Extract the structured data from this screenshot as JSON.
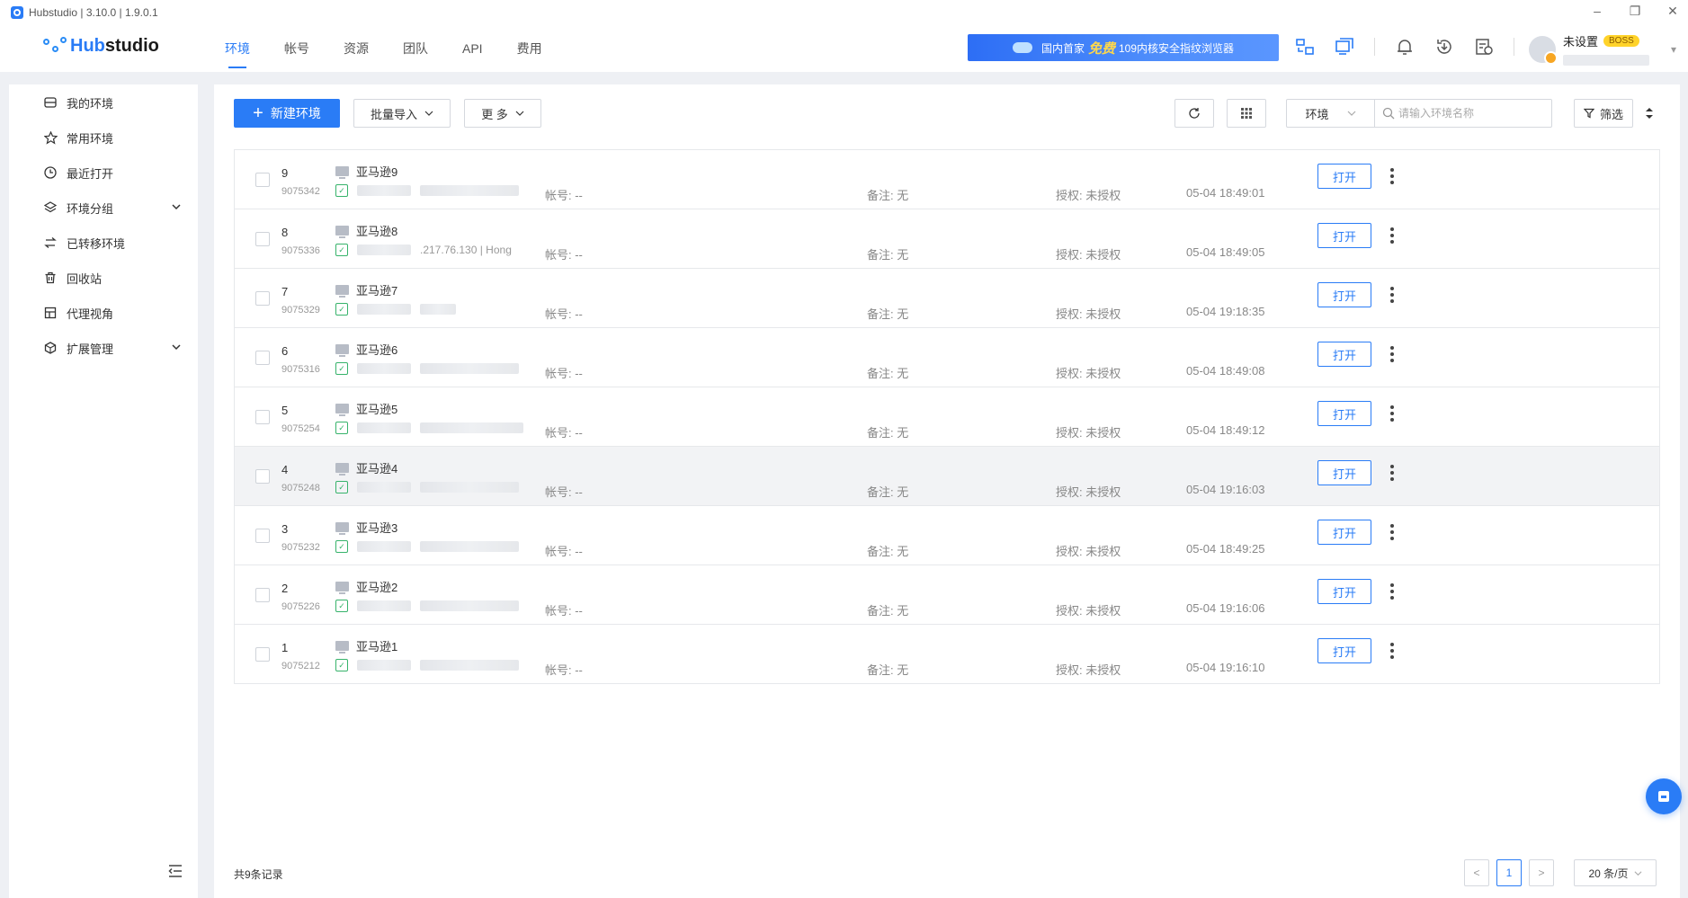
{
  "window": {
    "title": "Hubstudio | 3.10.0 | 1.9.0.1",
    "controls": [
      "–",
      "❐",
      "✕"
    ]
  },
  "brand": {
    "prefix": "Hub",
    "suffix": "studio"
  },
  "topnav": [
    {
      "label": "环境",
      "active": true
    },
    {
      "label": "帐号",
      "active": false
    },
    {
      "label": "资源",
      "active": false
    },
    {
      "label": "团队",
      "active": false
    },
    {
      "label": "API",
      "active": false
    },
    {
      "label": "费用",
      "active": false
    }
  ],
  "banner": {
    "pre": "国内首家",
    "free": "免费",
    "post": "109内核安全指纹浏览器"
  },
  "user": {
    "name": "未设置",
    "badge": "BOSS"
  },
  "sidebar": {
    "items": [
      {
        "label": "我的环境",
        "icon": "my-env-icon"
      },
      {
        "label": "常用环境",
        "icon": "star-icon"
      },
      {
        "label": "最近打开",
        "icon": "clock-icon"
      },
      {
        "label": "环境分组",
        "icon": "layers-icon",
        "expandable": true
      },
      {
        "label": "已转移环境",
        "icon": "transfer-icon"
      },
      {
        "label": "回收站",
        "icon": "trash-icon"
      },
      {
        "label": "代理视角",
        "icon": "proxy-view-icon"
      },
      {
        "label": "扩展管理",
        "icon": "extension-icon",
        "expandable": true
      }
    ]
  },
  "toolbar": {
    "new_env": "新建环境",
    "batch_import": "批量导入",
    "more": "更 多",
    "filter_type": "环境",
    "search_placeholder": "请输入环境名称",
    "filter": "筛选"
  },
  "rows": [
    {
      "seq": "9",
      "id": "9075342",
      "name": "亚马逊9",
      "proxy_text": "",
      "account": "帐号: --",
      "note": "备注: 无",
      "auth": "授权: 未授权",
      "time": "05-04 18:49:01",
      "open": "打开"
    },
    {
      "seq": "8",
      "id": "9075336",
      "name": "亚马逊8",
      "proxy_text": ".217.76.130 | Hong",
      "account": "帐号: --",
      "note": "备注: 无",
      "auth": "授权: 未授权",
      "time": "05-04 18:49:05",
      "open": "打开"
    },
    {
      "seq": "7",
      "id": "9075329",
      "name": "亚马逊7",
      "proxy_text": "",
      "account": "帐号: --",
      "note": "备注: 无",
      "auth": "授权: 未授权",
      "time": "05-04 19:18:35",
      "open": "打开"
    },
    {
      "seq": "6",
      "id": "9075316",
      "name": "亚马逊6",
      "proxy_text": "",
      "account": "帐号: --",
      "note": "备注: 无",
      "auth": "授权: 未授权",
      "time": "05-04 18:49:08",
      "open": "打开"
    },
    {
      "seq": "5",
      "id": "9075254",
      "name": "亚马逊5",
      "proxy_text": "",
      "account": "帐号: --",
      "note": "备注: 无",
      "auth": "授权: 未授权",
      "time": "05-04 18:49:12",
      "open": "打开"
    },
    {
      "seq": "4",
      "id": "9075248",
      "name": "亚马逊4",
      "proxy_text": "",
      "account": "帐号: --",
      "note": "备注: 无",
      "auth": "授权: 未授权",
      "time": "05-04 19:16:03",
      "open": "打开",
      "hover": true
    },
    {
      "seq": "3",
      "id": "9075232",
      "name": "亚马逊3",
      "proxy_text": "",
      "account": "帐号: --",
      "note": "备注: 无",
      "auth": "授权: 未授权",
      "time": "05-04 18:49:25",
      "open": "打开"
    },
    {
      "seq": "2",
      "id": "9075226",
      "name": "亚马逊2",
      "proxy_text": "",
      "account": "帐号: --",
      "note": "备注: 无",
      "auth": "授权: 未授权",
      "time": "05-04 19:16:06",
      "open": "打开"
    },
    {
      "seq": "1",
      "id": "9075212",
      "name": "亚马逊1",
      "proxy_text": "",
      "account": "帐号: --",
      "note": "备注: 无",
      "auth": "授权: 未授权",
      "time": "05-04 19:16:10",
      "open": "打开"
    }
  ],
  "footer": {
    "total": "共9条记录",
    "prev": "<",
    "page": "1",
    "next": ">",
    "page_size": "20 条/页"
  },
  "colors": {
    "accent": "#2a7cf6",
    "badge": "#ffd32a",
    "proxy_ok": "#37b36b"
  }
}
